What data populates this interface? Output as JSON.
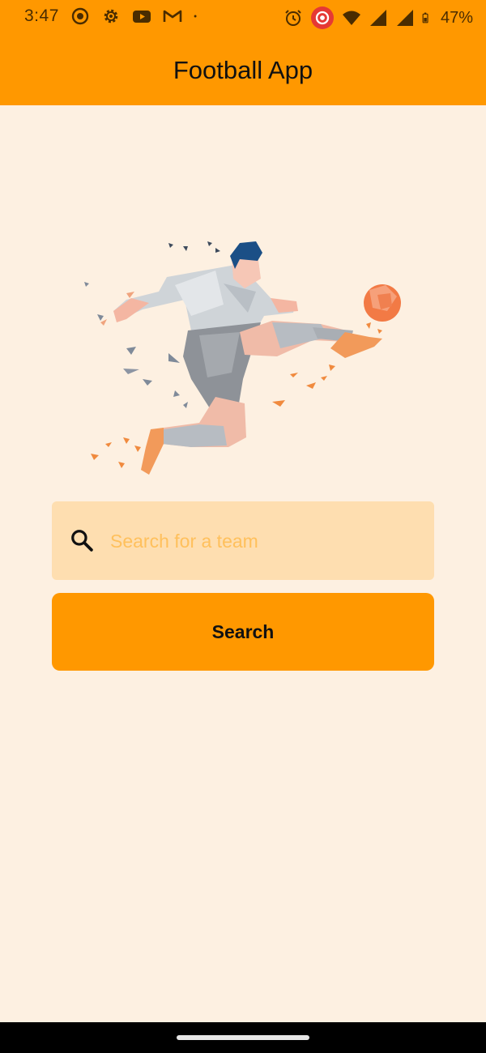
{
  "status_bar": {
    "time": "3:47",
    "battery_percent": "47%",
    "left_icons": [
      "record-icon",
      "settings-gear-icon",
      "youtube-icon",
      "gmail-icon",
      "notification-dot-icon"
    ],
    "right_icons": [
      "alarm-icon",
      "screen-record-icon",
      "wifi-icon",
      "signal-icon",
      "signal-icon",
      "battery-icon"
    ]
  },
  "app_bar": {
    "title": "Football App"
  },
  "hero": {
    "icon": "football-player-illustration"
  },
  "search": {
    "placeholder": "Search for a team",
    "value": "",
    "icon": "search-icon",
    "button_label": "Search"
  },
  "colors": {
    "primary": "#ff9800",
    "background": "#fdf0e1",
    "field_background": "#fedeb0",
    "placeholder": "#ffc05c"
  }
}
